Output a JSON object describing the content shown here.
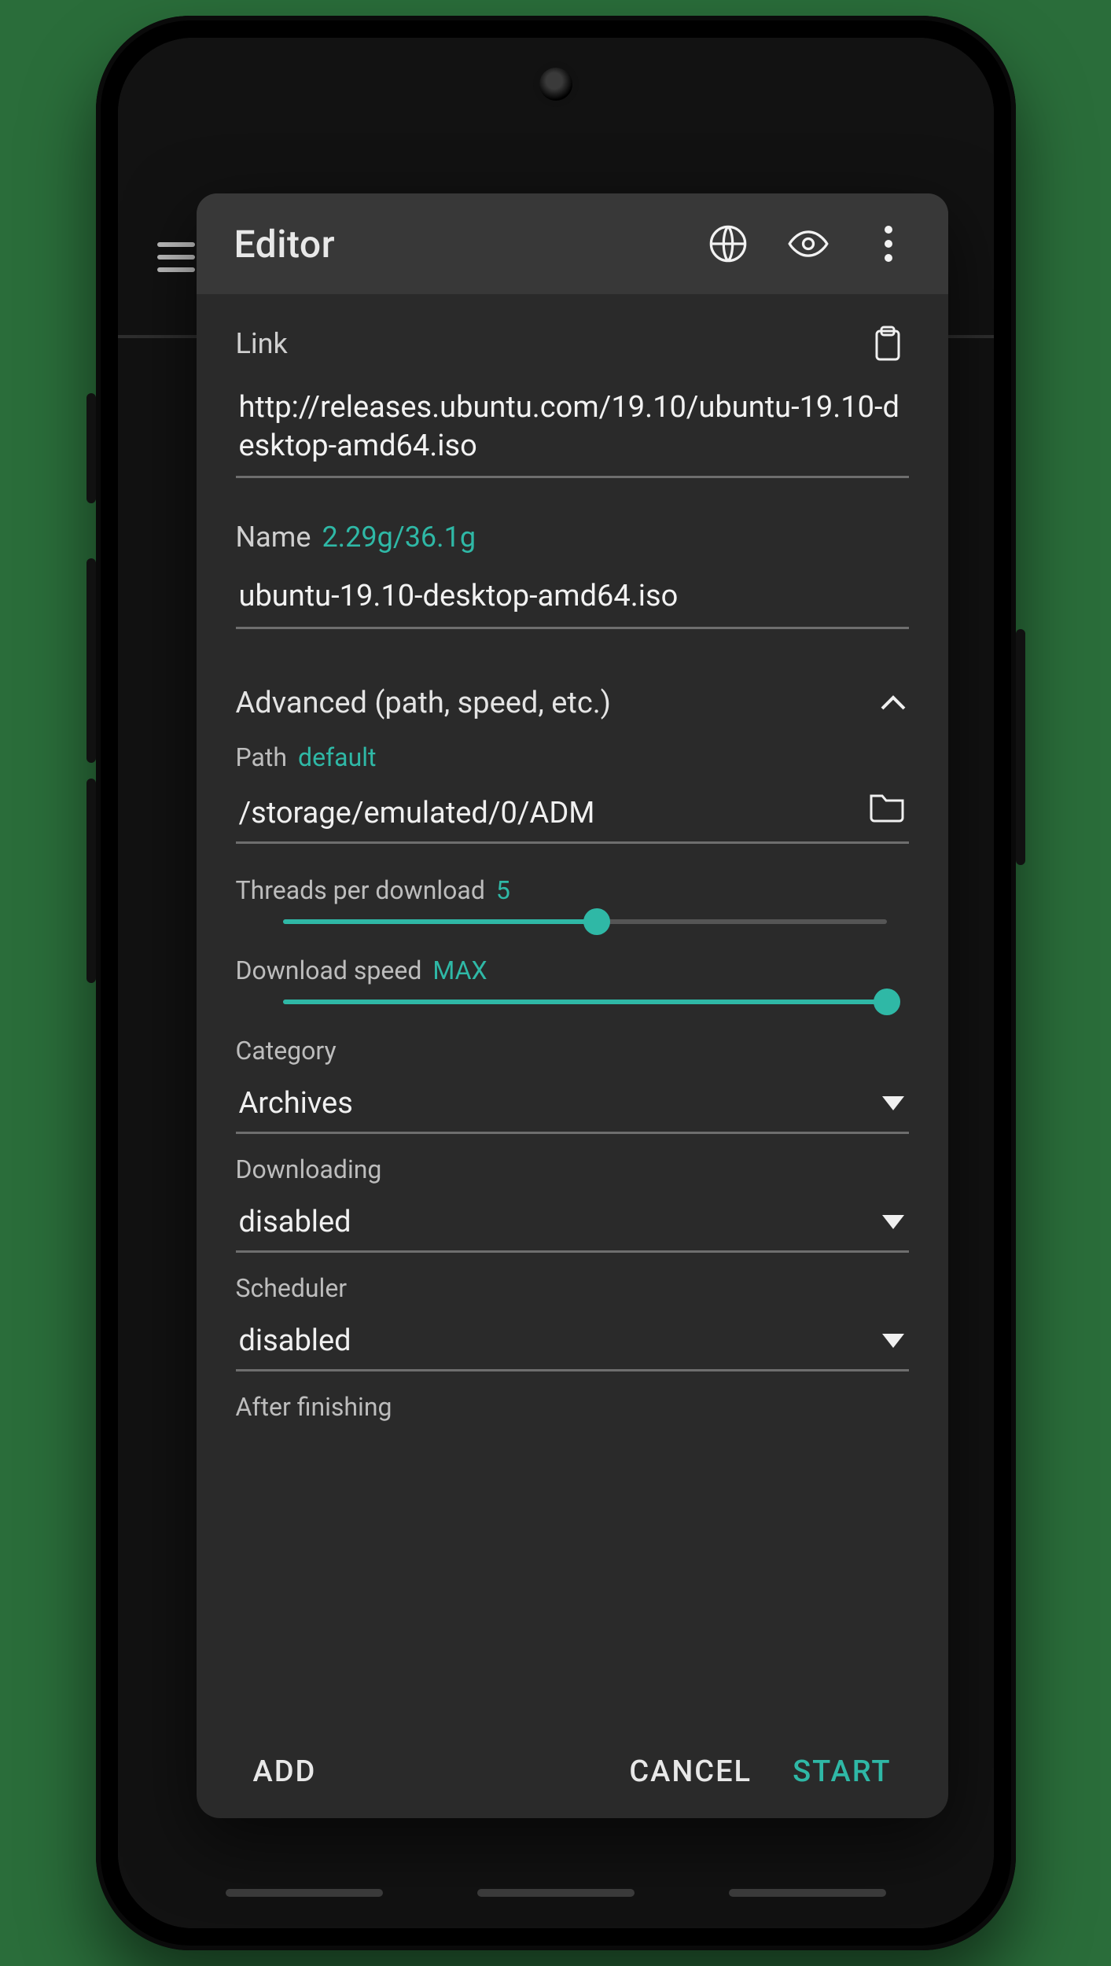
{
  "dialog": {
    "title": "Editor",
    "link": {
      "label": "Link",
      "value": "http://releases.ubuntu.com/19.10/ubuntu-19.10-desktop-amd64.iso"
    },
    "name": {
      "label": "Name",
      "size_hint": "2.29g/36.1g",
      "value": "ubuntu-19.10-desktop-amd64.iso"
    },
    "advanced_header": "Advanced (path, speed, etc.)",
    "path": {
      "label": "Path",
      "hint": "default",
      "value": "/storage/emulated/0/ADM"
    },
    "threads": {
      "label": "Threads per download",
      "value": "5",
      "percent": 52
    },
    "speed": {
      "label": "Download speed",
      "value": "MAX",
      "percent": 100
    },
    "category": {
      "label": "Category",
      "value": "Archives"
    },
    "downloading": {
      "label": "Downloading",
      "value": "disabled"
    },
    "scheduler": {
      "label": "Scheduler",
      "value": "disabled"
    },
    "after": {
      "label": "After finishing"
    }
  },
  "footer": {
    "add": "ADD",
    "cancel": "CANCEL",
    "start": "START"
  },
  "accent_color": "#2fb8a6"
}
